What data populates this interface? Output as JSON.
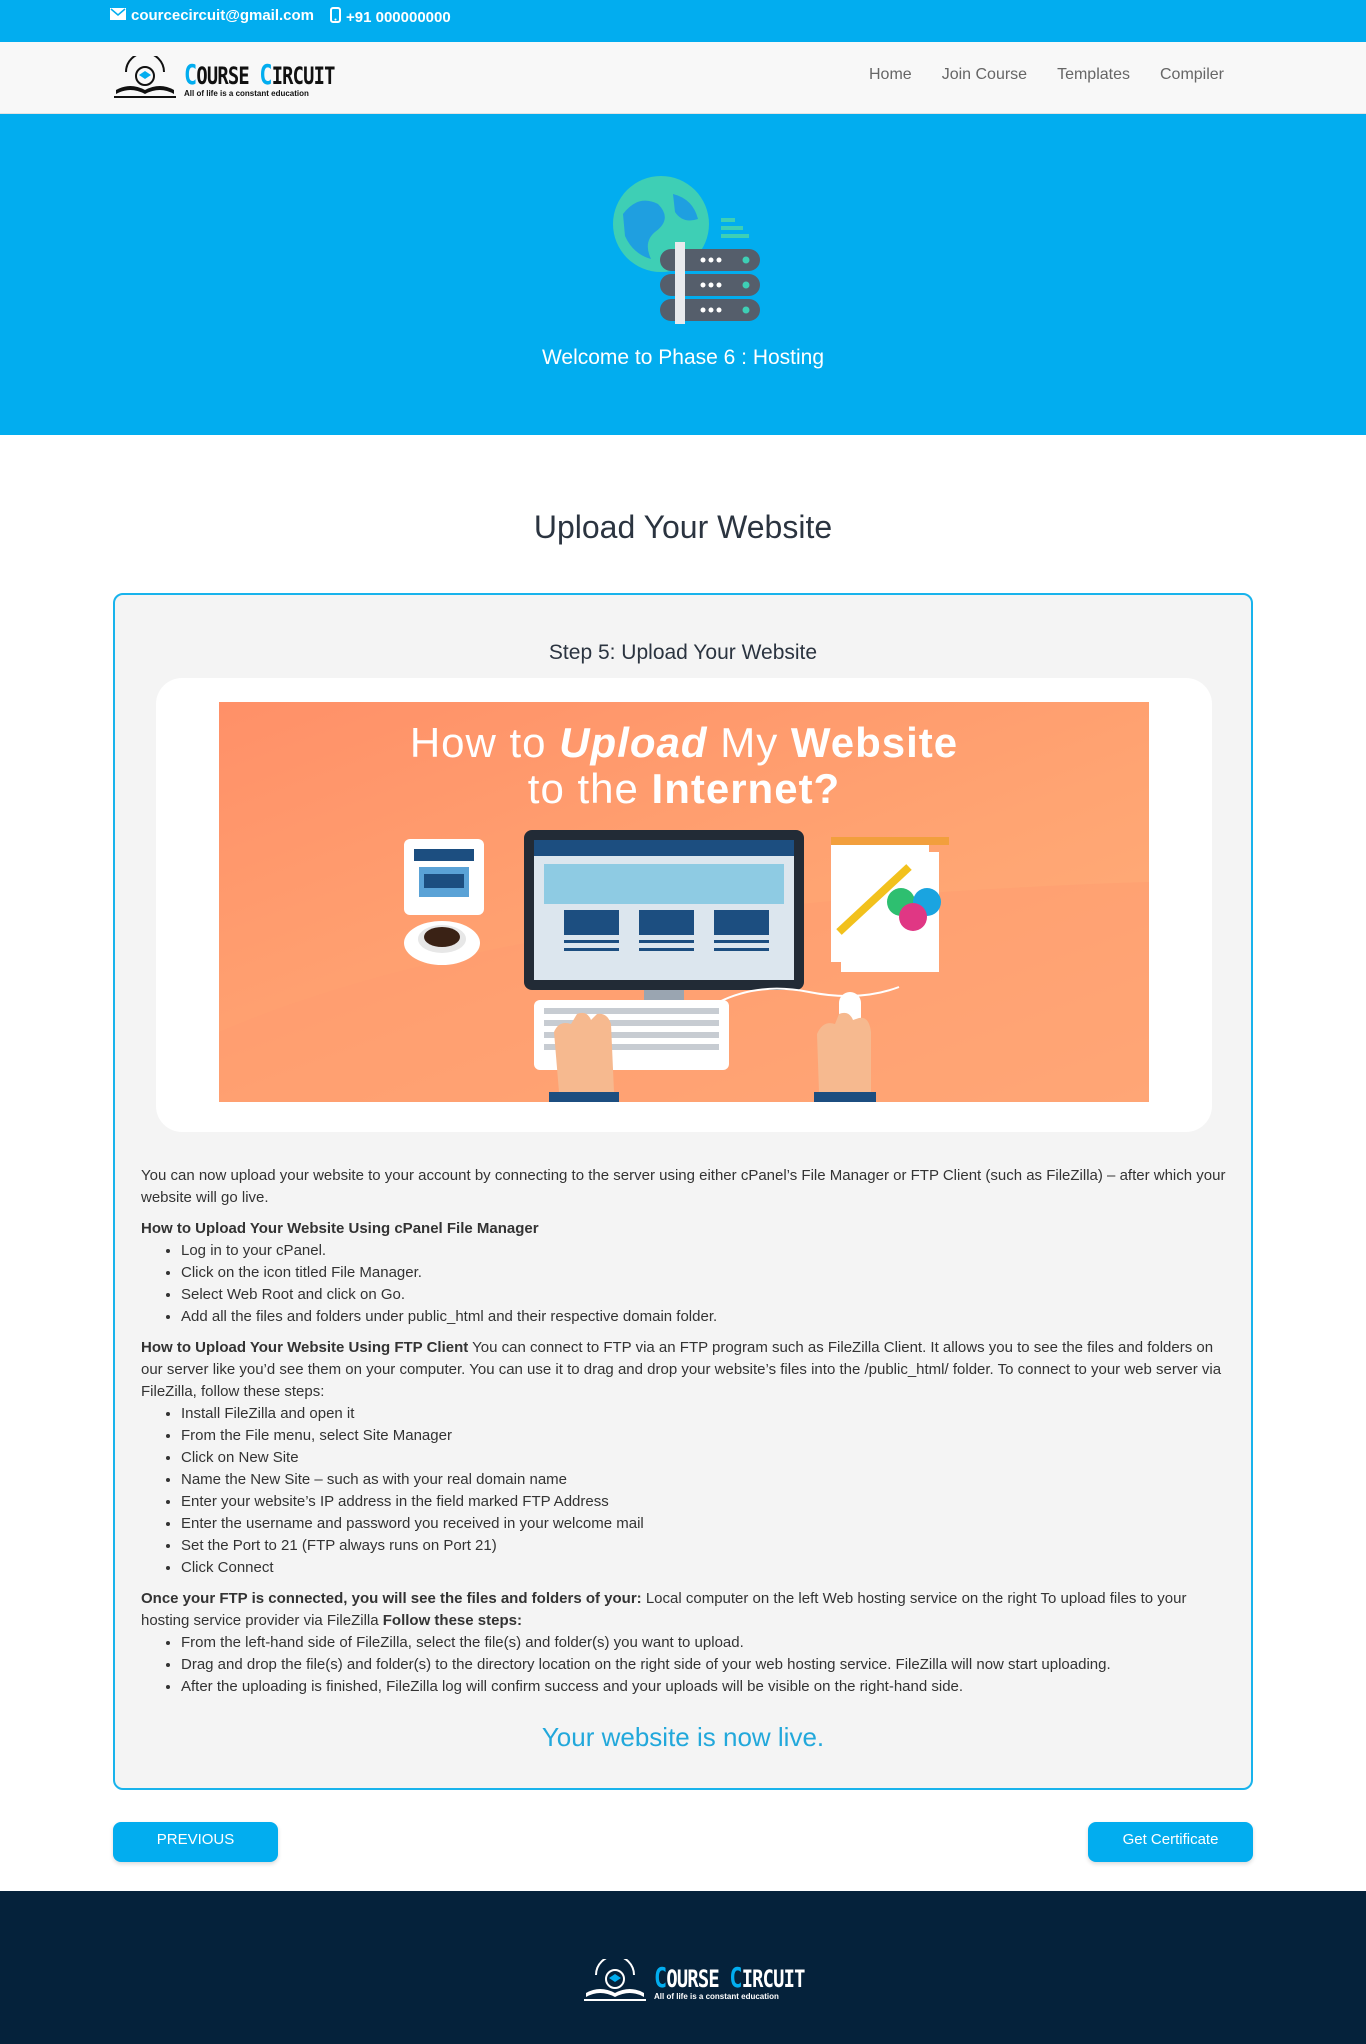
{
  "topbar": {
    "email": "courcecircuit@gmail.com",
    "phone": "+91 000000000"
  },
  "logo": {
    "brand_first_letter": "C",
    "brand_first_rest": "OURSE",
    "brand_second_letter": "C",
    "brand_second_rest": "IRCUIT",
    "tagline": "All of life is a constant education"
  },
  "nav": {
    "items": [
      "Home",
      "Join Course",
      "Templates",
      "Compiler"
    ]
  },
  "hero": {
    "title": "Welcome to Phase 6 : Hosting",
    "icon": "server-globe-icon"
  },
  "main": {
    "title": "Upload Your Website",
    "step_title": "Step 5: Upload Your Website",
    "banner": {
      "line1_a": "How to ",
      "line1_b": "Upload",
      "line1_c": " My ",
      "line1_d": "Website",
      "line2_a": "to the ",
      "line2_b": "Internet?"
    },
    "intro": "You can now upload your website to your account by connecting to the server using either cPanel’s File Manager or FTP Client (such as FileZilla) – after which your website will go live.",
    "cpanel_heading": "How to Upload Your Website Using cPanel File Manager",
    "cpanel_steps": [
      "Log in to your cPanel.",
      "Click on the icon titled File Manager.",
      "Select Web Root and click on Go.",
      "Add all the files and folders under public_html and their respective domain folder."
    ],
    "ftp_heading": "How to Upload Your Website Using FTP Client",
    "ftp_text": " You can connect to FTP via an FTP program such as FileZilla Client. It allows you to see the files and folders on our server like you’d see them on your computer. You can use it to drag and drop your website’s files into the /public_html/ folder. To connect to your web server via FileZilla, follow these steps:",
    "ftp_steps": [
      "Install FileZilla and open it",
      "From the File menu, select Site Manager",
      "Click on New Site",
      "Name the New Site – such as with your real domain name",
      "Enter your website’s IP address in the field marked FTP Address",
      "Enter the username and password you received in your welcome mail",
      "Set the Port to 21 (FTP always runs on Port 21)",
      "Click Connect"
    ],
    "connected_heading": "Once your FTP is connected, you will see the files and folders of your:",
    "connected_text": " Local computer on the left Web hosting service on the right To upload files to your hosting service provider via FileZilla ",
    "follow_label": "Follow these steps:",
    "upload_steps": [
      "From the left-hand side of FileZilla, select the file(s) and folder(s) you want to upload.",
      "Drag and drop the file(s) and folder(s) to the directory location on the right side of your web hosting service. FileZilla will now start uploading.",
      "After the uploading is finished, FileZilla log will confirm success and your uploads will be visible on the right-hand side."
    ],
    "live_text": "Your website is now live."
  },
  "buttons": {
    "previous": "PREVIOUS",
    "certificate": "Get Certificate"
  },
  "colors": {
    "accent": "#02adef",
    "footer": "#05223b"
  }
}
